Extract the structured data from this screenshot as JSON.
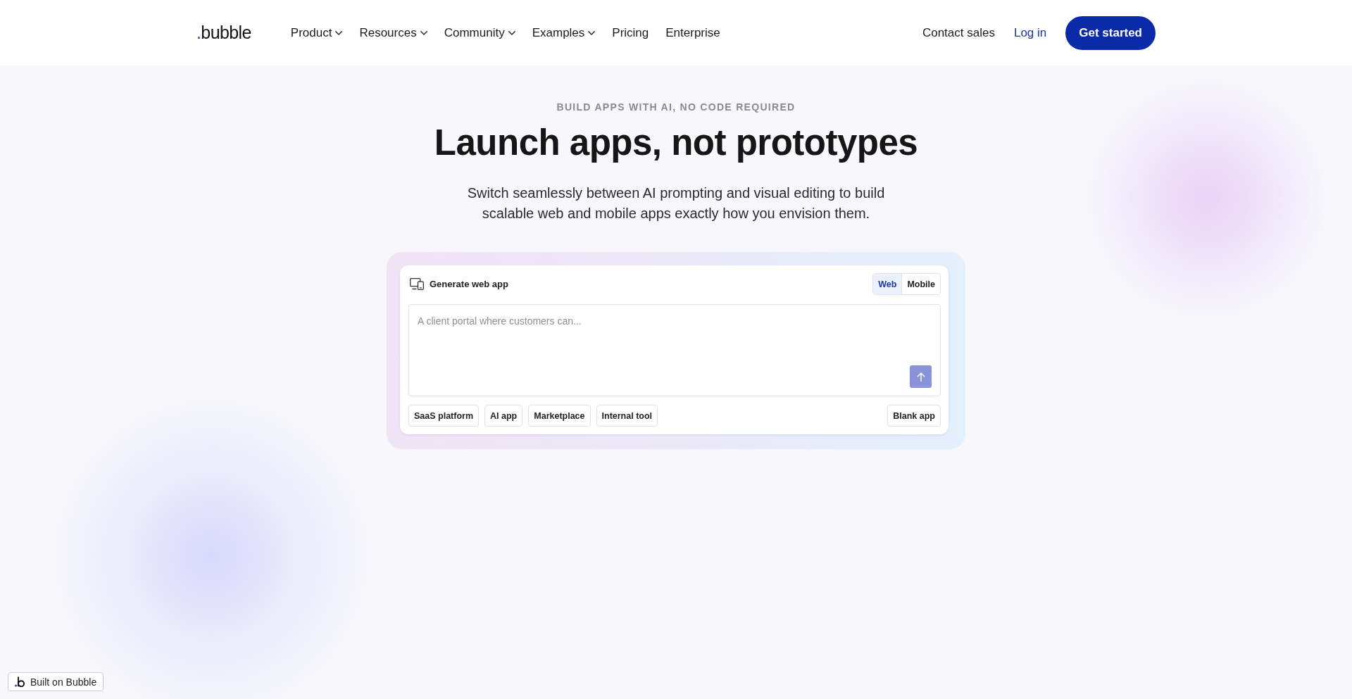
{
  "header": {
    "logo": ".bubble",
    "nav": [
      {
        "label": "Product",
        "dropdown": true
      },
      {
        "label": "Resources",
        "dropdown": true
      },
      {
        "label": "Community",
        "dropdown": true
      },
      {
        "label": "Examples",
        "dropdown": true
      },
      {
        "label": "Pricing",
        "dropdown": false
      },
      {
        "label": "Enterprise",
        "dropdown": false
      }
    ],
    "contact": "Contact sales",
    "login": "Log in",
    "cta": "Get started"
  },
  "hero": {
    "eyebrow": "BUILD APPS WITH AI, NO CODE REQUIRED",
    "title": "Launch apps, not prototypes",
    "subtitle": "Switch seamlessly between AI prompting and visual editing to build scalable web and mobile apps exactly how you envision them."
  },
  "generator": {
    "title": "Generate web app",
    "platforms": [
      {
        "label": "Web",
        "selected": true
      },
      {
        "label": "Mobile",
        "selected": false
      }
    ],
    "prompt": {
      "placeholder": "A client portal where customers can..."
    },
    "send_button": {
      "disabled": true
    },
    "templates": [
      "SaaS platform",
      "AI app",
      "Marketplace",
      "Internal tool"
    ],
    "blank_app": "Blank app"
  },
  "badge": {
    "label": "Built on Bubble"
  }
}
